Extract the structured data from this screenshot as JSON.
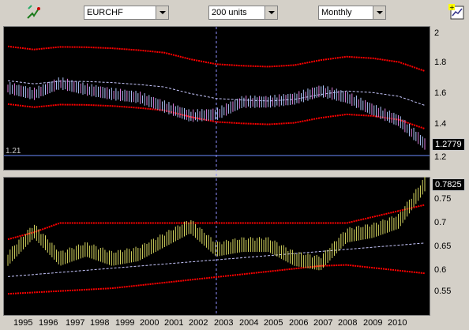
{
  "toolbar": {
    "symbol": "EURCHF",
    "units": "200 units",
    "period": "Monthly",
    "tool_icon": "drawing-tool-icon",
    "chart_icon": "chart-settings-icon"
  },
  "top_panel": {
    "y_ticks": [
      "2",
      "1.8",
      "1.6",
      "1.4",
      "1.2"
    ],
    "current_value": "1.2779",
    "hline_label": "1.21"
  },
  "bottom_panel": {
    "y_ticks": [
      "0.75",
      "0.7",
      "0.65",
      "0.6",
      "0.55"
    ],
    "current_value": "0.7825"
  },
  "x_axis": {
    "years": [
      "1995",
      "1996",
      "1997",
      "1998",
      "1999",
      "2000",
      "2001",
      "2002",
      "2003",
      "2004",
      "2005",
      "2006",
      "2007",
      "2008",
      "2009",
      "2010"
    ]
  },
  "colors": {
    "band": "#ff0000",
    "ma": "#c8c8ff",
    "price": "#b0c8ff",
    "osc": "#d8d860",
    "hline": "#6b8cff",
    "cursor": "#9090ff"
  },
  "chart_data": {
    "type": "line",
    "x": [
      1995,
      1996,
      1997,
      1998,
      1999,
      2000,
      2001,
      2002,
      2003,
      2004,
      2005,
      2006,
      2007,
      2008,
      2009,
      2010,
      2011
    ],
    "series": [
      {
        "name": "EURCHF",
        "values": [
          1.64,
          1.6,
          1.67,
          1.63,
          1.6,
          1.58,
          1.52,
          1.46,
          1.47,
          1.55,
          1.55,
          1.57,
          1.62,
          1.58,
          1.5,
          1.43,
          1.28
        ]
      },
      {
        "values": [
          0.62,
          0.68,
          0.62,
          0.64,
          0.62,
          0.63,
          0.66,
          0.69,
          0.64,
          0.65,
          0.65,
          0.62,
          0.61,
          0.67,
          0.68,
          0.7,
          0.78
        ]
      }
    ]
  }
}
